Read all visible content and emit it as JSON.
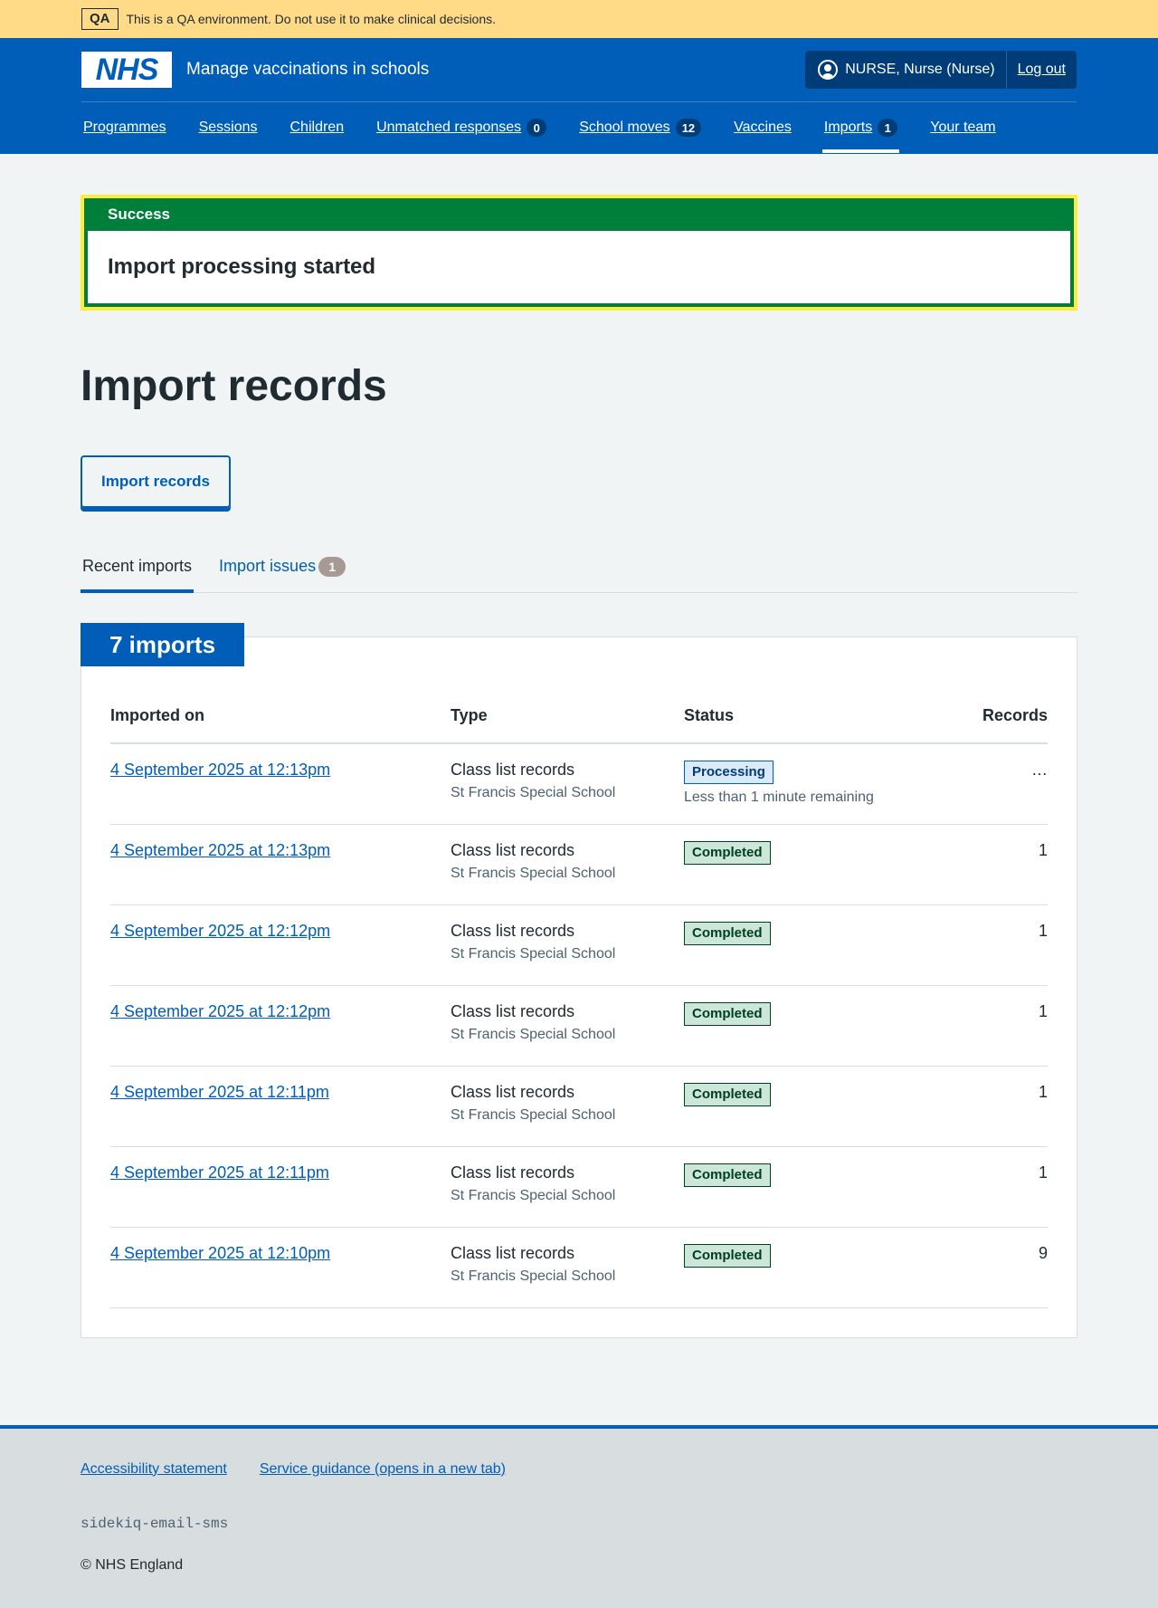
{
  "qa_banner": {
    "tag": "QA",
    "message": "This is a QA environment. Do not use it to make clinical decisions."
  },
  "header": {
    "logo_text": "NHS",
    "service_name": "Manage vaccinations in schools",
    "user_label": "NURSE, Nurse (Nurse)",
    "logout_label": "Log out",
    "nav": [
      {
        "label": "Programmes",
        "count": null
      },
      {
        "label": "Sessions",
        "count": null
      },
      {
        "label": "Children",
        "count": null
      },
      {
        "label": "Unmatched responses",
        "count": "0"
      },
      {
        "label": "School moves",
        "count": "12"
      },
      {
        "label": "Vaccines",
        "count": null
      },
      {
        "label": "Imports",
        "count": "1",
        "active": true
      },
      {
        "label": "Your team",
        "count": null
      }
    ]
  },
  "notification": {
    "title": "Success",
    "message": "Import processing started"
  },
  "page": {
    "title": "Import records",
    "import_button": "Import records",
    "tabs": [
      {
        "label": "Recent imports",
        "active": true
      },
      {
        "label": "Import issues",
        "count": "1"
      }
    ]
  },
  "imports_table": {
    "heading": "7 imports",
    "columns": [
      "Imported on",
      "Type",
      "Status",
      "Records"
    ],
    "rows": [
      {
        "date": "4 September 2025 at 12:13pm",
        "type": "Class list records",
        "school": "St Francis Special School",
        "status": "Processing",
        "status_detail": "Less than 1 minute remaining",
        "records": "…"
      },
      {
        "date": "4 September 2025 at 12:13pm",
        "type": "Class list records",
        "school": "St Francis Special School",
        "status": "Completed",
        "status_detail": "",
        "records": "1"
      },
      {
        "date": "4 September 2025 at 12:12pm",
        "type": "Class list records",
        "school": "St Francis Special School",
        "status": "Completed",
        "status_detail": "",
        "records": "1"
      },
      {
        "date": "4 September 2025 at 12:12pm",
        "type": "Class list records",
        "school": "St Francis Special School",
        "status": "Completed",
        "status_detail": "",
        "records": "1"
      },
      {
        "date": "4 September 2025 at 12:11pm",
        "type": "Class list records",
        "school": "St Francis Special School",
        "status": "Completed",
        "status_detail": "",
        "records": "1"
      },
      {
        "date": "4 September 2025 at 12:11pm",
        "type": "Class list records",
        "school": "St Francis Special School",
        "status": "Completed",
        "status_detail": "",
        "records": "1"
      },
      {
        "date": "4 September 2025 at 12:10pm",
        "type": "Class list records",
        "school": "St Francis Special School",
        "status": "Completed",
        "status_detail": "",
        "records": "9"
      }
    ]
  },
  "footer": {
    "links": [
      "Accessibility statement",
      "Service guidance (opens in a new tab)"
    ],
    "code": "sidekiq-email-sms",
    "copyright": "© NHS England"
  },
  "colors": {
    "nhs_blue": "#005eb8",
    "success_green": "#007f3b",
    "qa_yellow": "#ffdb88",
    "focus_yellow": "#ffeb3b"
  }
}
